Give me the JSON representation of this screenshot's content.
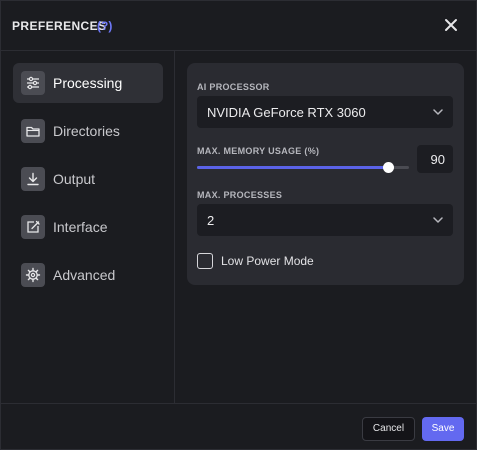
{
  "dialog": {
    "title": "PREFERENCES",
    "help_label": "(?)",
    "close_icon": "close-icon"
  },
  "sidebar": {
    "items": [
      {
        "label": "Processing",
        "icon": "sliders-icon",
        "active": true
      },
      {
        "label": "Directories",
        "icon": "folder-icon",
        "active": false
      },
      {
        "label": "Output",
        "icon": "download-icon",
        "active": false
      },
      {
        "label": "Interface",
        "icon": "edit-icon",
        "active": false
      },
      {
        "label": "Advanced",
        "icon": "gear-icon",
        "active": false
      }
    ]
  },
  "processing": {
    "ai_processor_label": "AI PROCESSOR",
    "ai_processor_value": "NVIDIA GeForce RTX 3060",
    "memory_label": "MAX. MEMORY USAGE (%)",
    "memory_value": "90",
    "memory_fraction": 0.9,
    "processes_label": "MAX. PROCESSES",
    "processes_value": "2",
    "low_power_label": "Low Power Mode",
    "low_power_checked": false
  },
  "footer": {
    "cancel_label": "Cancel",
    "save_label": "Save"
  },
  "colors": {
    "accent": "#6369f0",
    "background": "#1b1c20",
    "panel": "#2a2b31"
  }
}
